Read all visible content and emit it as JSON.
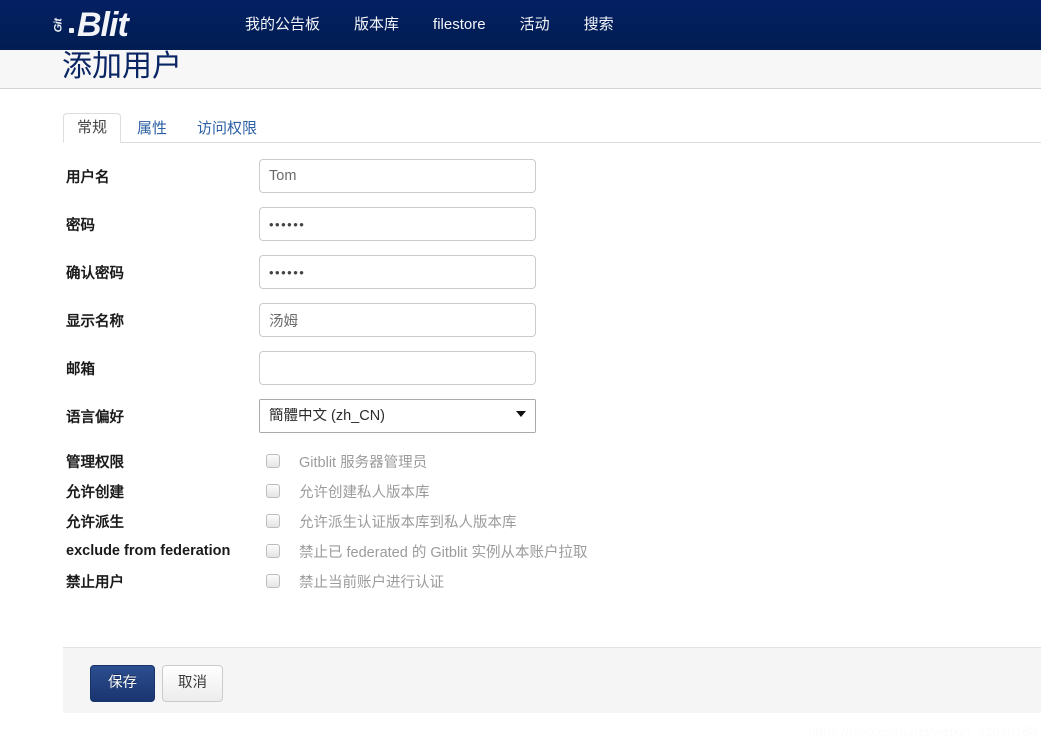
{
  "navbar": {
    "brand": {
      "git_text": "Git",
      "blit_text": "Blit"
    },
    "links": [
      {
        "label": "我的公告板"
      },
      {
        "label": "版本库"
      },
      {
        "label": "filestore"
      },
      {
        "label": "活动"
      },
      {
        "label": "搜索"
      }
    ],
    "background_color": "#01215c"
  },
  "header": {
    "title": "添加用户"
  },
  "tabs": [
    {
      "label": "常规",
      "active": true
    },
    {
      "label": "属性",
      "active": false
    },
    {
      "label": "访问权限",
      "active": false
    }
  ],
  "form": {
    "fields": [
      {
        "label": "用户名",
        "value": "Tom",
        "placeholder": ""
      },
      {
        "label": "密码",
        "value": "••••••",
        "placeholder": ""
      },
      {
        "label": "确认密码",
        "value": "••••••",
        "placeholder": ""
      },
      {
        "label": "显示名称",
        "value": "汤姆",
        "placeholder": ""
      },
      {
        "label": "邮箱",
        "value": "",
        "placeholder": ""
      }
    ],
    "language": {
      "label": "语言偏好",
      "selected": "簡體中文 (zh_CN)",
      "options": [
        "簡體中文 (zh_CN)"
      ]
    },
    "permissions": [
      {
        "label": "管理权限",
        "description": "Gitblit 服务器管理员",
        "checked": false
      },
      {
        "label": "允许创建",
        "description": "允许创建私人版本库",
        "checked": false
      },
      {
        "label": "允许派生",
        "description": "允许派生认证版本库到私人版本库",
        "checked": false
      },
      {
        "label": "exclude from federation",
        "description": "禁止已 federated 的 Gitblit 实例从本账户拉取",
        "checked": false
      },
      {
        "label": "禁止用户",
        "description": "禁止当前账户进行认证",
        "checked": false
      }
    ]
  },
  "buttons": {
    "save": "保存",
    "cancel": "取消"
  },
  "watermark": "https://blog.csdn.net/weixin_41049188"
}
